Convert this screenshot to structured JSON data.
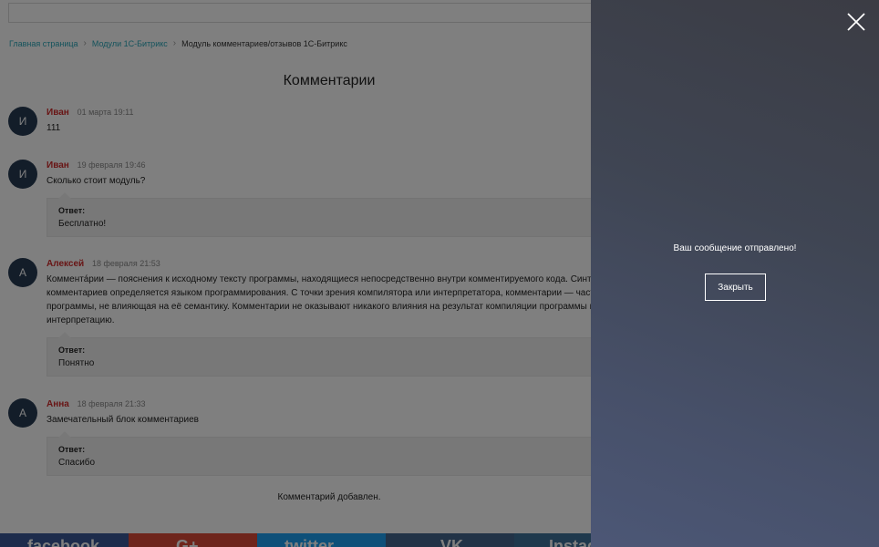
{
  "breadcrumb": {
    "items": [
      {
        "label": "Главная страница"
      },
      {
        "label": "Модули 1С-Битрикс"
      },
      {
        "label": "Модуль комментариев/отзывов 1С-Битрикс"
      }
    ]
  },
  "page_title": "Комментарии",
  "comments": [
    {
      "initial": "И",
      "author": "Иван",
      "date": "01 марта 19:11",
      "text": "111"
    },
    {
      "initial": "И",
      "author": "Иван",
      "date": "19 февраля 19:46",
      "text": "Сколько стоит модуль?",
      "reply": {
        "label": "Ответ:",
        "text": "Бесплатно!"
      }
    },
    {
      "initial": "А",
      "author": "Алексей",
      "date": "18 февраля 21:53",
      "text": "Коммента́рии — пояснения к исходному тексту программы, находящиеся непосредственно внутри комментируемого кода. Синтаксис комментариев определяется языком программирования. С точки зрения компилятора или интерпретатора, комментарии — часть текста программы, не влияющая на её семантику. Комментарии не оказывают никакого влияния на результат компиляции программы или её интерпретацию.",
      "reply": {
        "label": "Ответ:",
        "text": "Понятно"
      }
    },
    {
      "initial": "А",
      "author": "Анна",
      "date": "18 февраля 21:33",
      "text": "Замечательный блок комментариев",
      "reply": {
        "label": "Ответ:",
        "text": "Спасибо"
      }
    }
  ],
  "notice": "Комментарий добавлен.",
  "socials": {
    "facebook": "facebook",
    "google": "G+",
    "twitter": "twitter",
    "vk": "VK",
    "instagram": "Instagram"
  },
  "modal": {
    "message": "Ваш сообщение отправлено!",
    "close_button": "Закрыть",
    "close_icon": "close-icon"
  },
  "colors": {
    "author": "#d12b2b",
    "link": "#2aa6b8",
    "avatar": "#263a52",
    "panel_top": "#3b3c44",
    "panel_bottom": "#4c5776"
  }
}
